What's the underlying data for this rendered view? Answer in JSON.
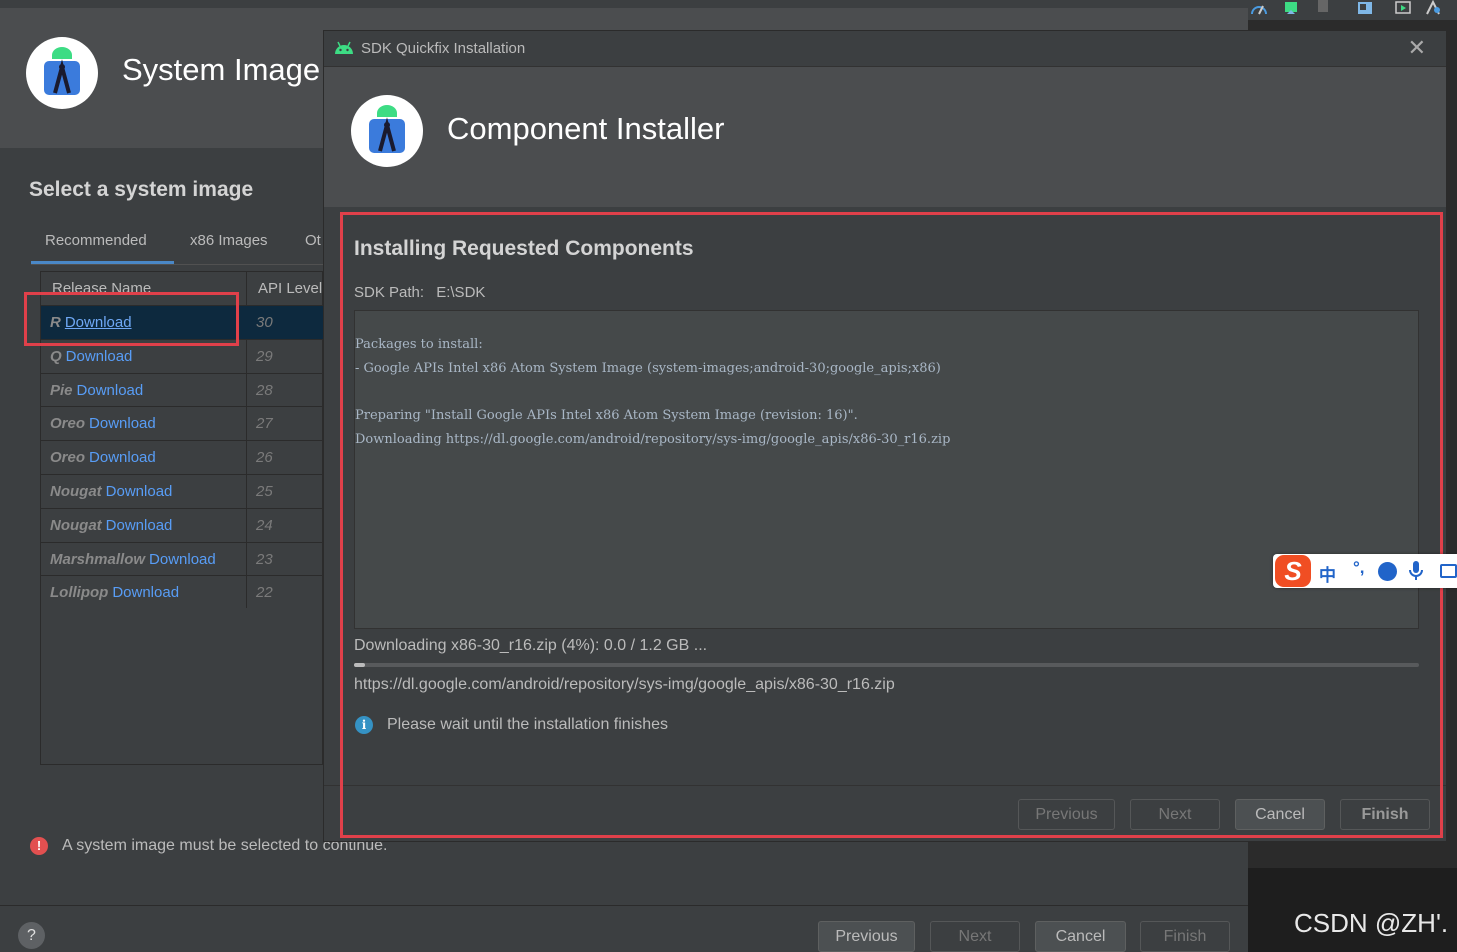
{
  "background_wizard": {
    "title": "System Image",
    "section_title": "Select a system image",
    "tabs": [
      "Recommended",
      "x86 Images",
      "Ot"
    ],
    "columns": [
      "Release Name",
      "API Level"
    ],
    "rows": [
      {
        "release": "R",
        "link": "Download",
        "api": "30"
      },
      {
        "release": "Q",
        "link": "Download",
        "api": "29"
      },
      {
        "release": "Pie",
        "link": "Download",
        "api": "28"
      },
      {
        "release": "Oreo",
        "link": "Download",
        "api": "27"
      },
      {
        "release": "Oreo",
        "link": "Download",
        "api": "26"
      },
      {
        "release": "Nougat",
        "link": "Download",
        "api": "25"
      },
      {
        "release": "Nougat",
        "link": "Download",
        "api": "24"
      },
      {
        "release": "Marshmallow",
        "link": "Download",
        "api": "23"
      },
      {
        "release": "Lollipop",
        "link": "Download",
        "api": "22"
      }
    ],
    "error_message": "A system image must be selected to continue.",
    "help_label": "?",
    "buttons": {
      "previous": "Previous",
      "next": "Next",
      "cancel": "Cancel",
      "finish": "Finish"
    }
  },
  "installer": {
    "window_title": "SDK Quickfix Installation",
    "close_glyph": "✕",
    "header_title": "Component Installer",
    "heading": "Installing Requested Components",
    "sdk_path_label": "SDK Path:",
    "sdk_path_value": "E:\\SDK",
    "log_lines": [
      "Packages to install:",
      "- Google APIs Intel x86 Atom System Image (system-images;android-30;google_apis;x86)",
      "",
      "Preparing \"Install Google APIs Intel x86 Atom System Image (revision: 16)\".",
      "Downloading https://dl.google.com/android/repository/sys-img/google_apis/x86-30_r16.zip"
    ],
    "download_status": "Downloading x86-30_r16.zip (4%): 0.0 / 1.2 GB ...",
    "progress_fraction": 0.01,
    "download_url": "https://dl.google.com/android/repository/sys-img/google_apis/x86-30_r16.zip",
    "info_message": "Please wait until the installation finishes",
    "buttons": {
      "previous": "Previous",
      "next": "Next",
      "cancel": "Cancel",
      "finish": "Finish"
    }
  },
  "ime": {
    "logo": "S",
    "mode": "中",
    "punct": "°,"
  },
  "watermark": "CSDN @ZH'.",
  "colors": {
    "accent_blue": "#4a88c7",
    "link_blue": "#589df6",
    "highlight_red": "#e0404a",
    "error_red": "#e25050",
    "info_blue": "#3592c4",
    "ime_orange": "#f04e23"
  },
  "icons": [
    "android-studio-logo-icon",
    "android-icon",
    "close-icon",
    "error-icon",
    "info-icon",
    "help-icon",
    "microphone-icon",
    "keyboard-icon",
    "emoji-icon"
  ]
}
